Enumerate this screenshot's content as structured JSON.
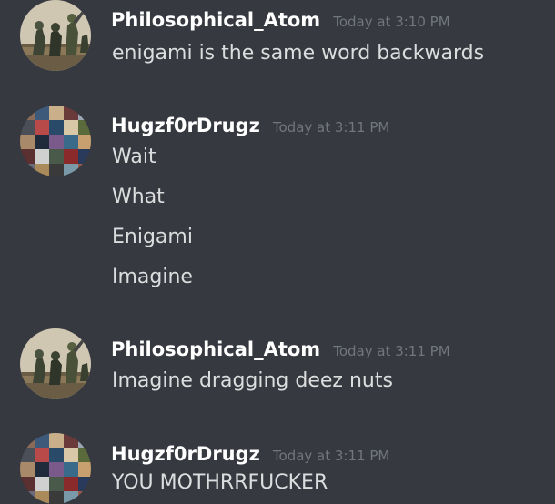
{
  "messages": [
    {
      "username": "Philosophical_Atom",
      "timestamp": "Today at 3:10 PM",
      "avatar_icon": "halo-soldiers-avatar",
      "lines": [
        "enigami is the same word backwards"
      ]
    },
    {
      "username": "Hugzf0rDrugz",
      "timestamp": "Today at 3:11 PM",
      "avatar_icon": "collage-avatar",
      "lines": [
        "Wait",
        "What",
        "Enigami",
        "Imagine"
      ]
    },
    {
      "username": "Philosophical_Atom",
      "timestamp": "Today at 3:11 PM",
      "avatar_icon": "halo-soldiers-avatar",
      "lines": [
        "Imagine dragging deez nuts"
      ]
    },
    {
      "username": "Hugzf0rDrugz",
      "timestamp": "Today at 3:11 PM",
      "avatar_icon": "collage-avatar",
      "lines": [
        "YOU MOTHRRFUCKER"
      ]
    }
  ],
  "colors": {
    "background": "#36393f",
    "username": "#ffffff",
    "timestamp": "#72767d",
    "message_text": "#dcddde"
  }
}
